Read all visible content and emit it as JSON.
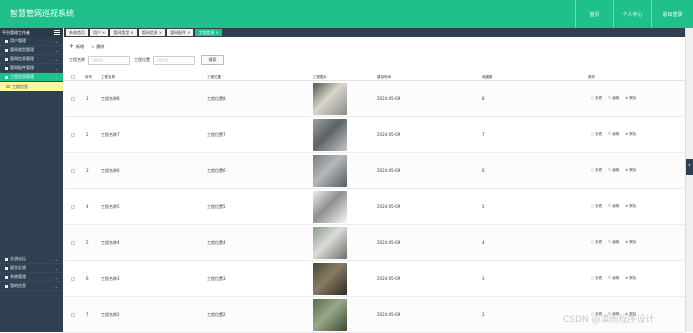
{
  "app": {
    "title": "智慧管网巡视系统",
    "top_nav": [
      "首页",
      "个人中心",
      "退出登录"
    ]
  },
  "sidebar": {
    "header": "平台管理工作者",
    "items": [
      {
        "label": "用户管理",
        "active": false
      },
      {
        "label": "管网类型管理",
        "active": false
      },
      {
        "label": "管网信息管理",
        "active": false
      },
      {
        "label": "管网配件管理",
        "active": false
      },
      {
        "label": "工程信息管理",
        "active": true
      }
    ],
    "sub_item": "工程信息",
    "bottom_items": [
      "交流论坛",
      "留言反馈",
      "系统管理",
      "我的信息"
    ]
  },
  "tabs": [
    {
      "label": "系统首页",
      "closable": false,
      "active": false
    },
    {
      "label": "用户",
      "closable": true,
      "active": false
    },
    {
      "label": "管网类型",
      "closable": true,
      "active": false
    },
    {
      "label": "管网信息",
      "closable": true,
      "active": false
    },
    {
      "label": "管网配件",
      "closable": true,
      "active": false
    },
    {
      "label": "工程信息",
      "closable": true,
      "active": true
    }
  ],
  "toolbar": {
    "add": "新增",
    "delete": "删除"
  },
  "search": {
    "name_label": "工程名称",
    "name_placeholder": "工程名称",
    "loc_label": "工程位置",
    "loc_placeholder": "工程位置",
    "button": "搜索"
  },
  "table": {
    "columns": [
      "序号",
      "工程名称",
      "工程位置",
      "工程图片",
      "建设时间",
      "收藏数",
      "操作"
    ],
    "rows": [
      {
        "index": "1",
        "name": "工程名称8",
        "location": "工程位置8",
        "date": "2024-05-09",
        "favorites": "8",
        "img_colors": [
          "#4a5a4a",
          "#d9d6cc",
          "#8a8a86"
        ]
      },
      {
        "index": "2",
        "name": "工程名称7",
        "location": "工程位置7",
        "date": "2024-05-09",
        "favorites": "7",
        "img_colors": [
          "#9aa0a4",
          "#5c6266",
          "#c3c8cc"
        ]
      },
      {
        "index": "3",
        "name": "工程名称6",
        "location": "工程位置6",
        "date": "2024-05-09",
        "favorites": "6",
        "img_colors": [
          "#7a7e80",
          "#b4b8bb",
          "#555a5e"
        ]
      },
      {
        "index": "4",
        "name": "工程名称5",
        "location": "工程位置5",
        "date": "2024-05-09",
        "favorites": "5",
        "img_colors": [
          "#eeeeea",
          "#8f8f8f",
          "#f8f8f6"
        ]
      },
      {
        "index": "5",
        "name": "工程名称4",
        "location": "工程位置4",
        "date": "2024-05-09",
        "favorites": "4",
        "img_colors": [
          "#8a9a8a",
          "#dcdcd8",
          "#6a6e6a"
        ]
      },
      {
        "index": "6",
        "name": "工程名称3",
        "location": "工程位置3",
        "date": "2024-05-09",
        "favorites": "3",
        "img_colors": [
          "#4a4438",
          "#8a7c62",
          "#2e2a24"
        ]
      },
      {
        "index": "7",
        "name": "工程名称2",
        "location": "工程位置2",
        "date": "2024-05-09",
        "favorites": "2",
        "img_colors": [
          "#5a6a4a",
          "#9aa88a",
          "#3a4a30"
        ]
      }
    ],
    "actions": [
      "查看",
      "编辑",
      "删除"
    ]
  },
  "watermark": "CSDN @漠雨程序设计"
}
